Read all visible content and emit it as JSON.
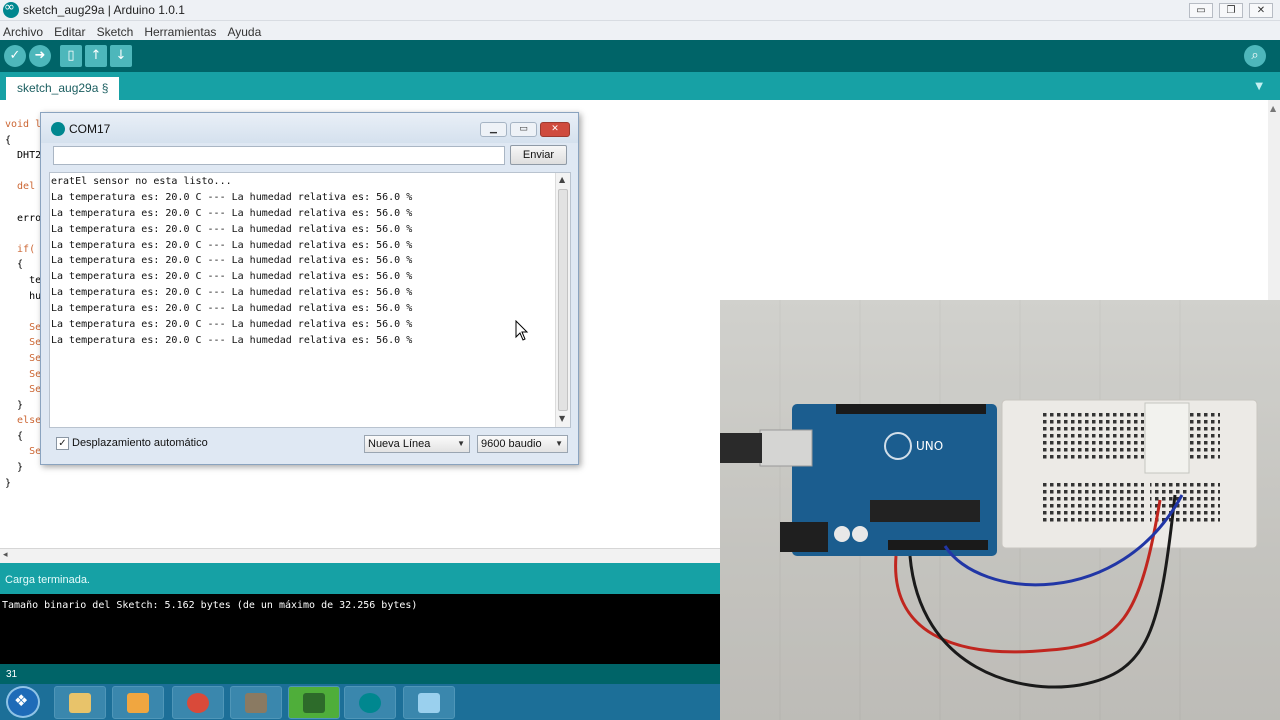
{
  "window": {
    "title": "sketch_aug29a | Arduino 1.0.1",
    "controls": [
      "▭",
      "❐",
      "✕"
    ]
  },
  "menu": [
    "Archivo",
    "Editar",
    "Sketch",
    "Herramientas",
    "Ayuda"
  ],
  "toolbar": {
    "verify_icon": "checkmark-icon",
    "upload_icon": "arrow-right-icon",
    "new_icon": "new-file-icon",
    "open_icon": "open-icon",
    "save_icon": "save-icon",
    "serial_monitor_icon": "magnifier-icon"
  },
  "tab": {
    "active_label": "sketch_aug29a §",
    "menu_glyph": "▼"
  },
  "code_lines": [
    {
      "text": "void l",
      "kw": true
    },
    {
      "text": "{",
      "kw": false
    },
    {
      "text": "  DHT2",
      "kw": false
    },
    {
      "text": "",
      "kw": false
    },
    {
      "text": "  del",
      "kw": true
    },
    {
      "text": "",
      "kw": false
    },
    {
      "text": "  erro",
      "kw": false
    },
    {
      "text": "",
      "kw": false
    },
    {
      "text": "  if(",
      "kw": true
    },
    {
      "text": "  {",
      "kw": false
    },
    {
      "text": "    te",
      "kw": false
    },
    {
      "text": "    hu",
      "kw": false
    },
    {
      "text": "",
      "kw": false
    },
    {
      "text": "    Se",
      "kw": true
    },
    {
      "text": "    Se",
      "kw": true
    },
    {
      "text": "    Se",
      "kw": true
    },
    {
      "text": "    Se",
      "kw": true
    },
    {
      "text": "    Se",
      "kw": true
    },
    {
      "text": "  }",
      "kw": false
    },
    {
      "text": "  else",
      "kw": true
    },
    {
      "text": "  {",
      "kw": false
    },
    {
      "text": "    Se",
      "kw": true
    },
    {
      "text": "  }",
      "kw": false
    },
    {
      "text": "}",
      "kw": false
    }
  ],
  "status": {
    "message": "Carga terminada.",
    "console": "Tamaño binario del Sketch: 5.162 bytes (de un máximo de 32.256 bytes)",
    "line_number": "31"
  },
  "serial_monitor": {
    "title": "COM17",
    "input_value": "",
    "send_label": "Enviar",
    "output_lines": [
      "eratEl sensor no esta listo...",
      "La temperatura es: 20.0 C --- La humedad relativa es: 56.0 %",
      "La temperatura es: 20.0 C --- La humedad relativa es: 56.0 %",
      "La temperatura es: 20.0 C --- La humedad relativa es: 56.0 %",
      "La temperatura es: 20.0 C --- La humedad relativa es: 56.0 %",
      "La temperatura es: 20.0 C --- La humedad relativa es: 56.0 %",
      "La temperatura es: 20.0 C --- La humedad relativa es: 56.0 %",
      "La temperatura es: 20.0 C --- La humedad relativa es: 56.0 %",
      "La temperatura es: 20.0 C --- La humedad relativa es: 56.0 %",
      "La temperatura es: 20.0 C --- La humedad relativa es: 56.0 %",
      "La temperatura es: 20.0 C --- La humedad relativa es: 56.0 %"
    ],
    "autoscroll_label": "Desplazamiento automático",
    "autoscroll_checked": true,
    "line_ending": "Nueva Línea",
    "baud_rate": "9600 baudio"
  },
  "taskbar": {
    "items": [
      "start-orb",
      "file-explorer-icon",
      "media-player-icon",
      "chrome-icon",
      "gimp-icon",
      "arduino-sketch-icon",
      "arduino-ide-icon",
      "notepad-icon"
    ]
  },
  "colors": {
    "arduino_dark": "#006468",
    "arduino_teal": "#17a1a5",
    "keyword": "#cc6633",
    "console_bg": "#000000"
  }
}
